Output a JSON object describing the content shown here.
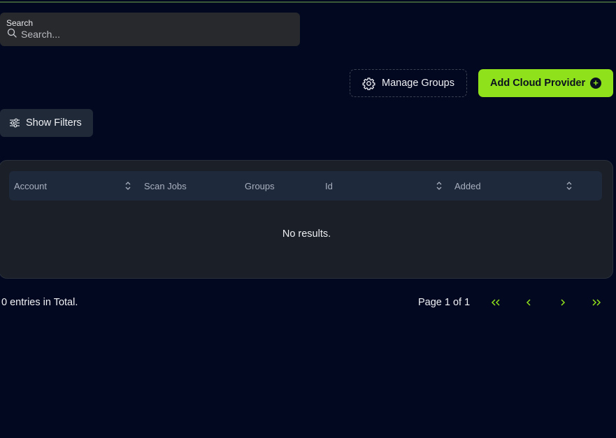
{
  "search": {
    "label": "Search",
    "placeholder": "Search...",
    "value": ""
  },
  "toolbar": {
    "manage_groups_label": "Manage Groups",
    "add_provider_label": "Add Cloud Provider",
    "show_filters_label": "Show Filters"
  },
  "table": {
    "columns": [
      {
        "label": "Account",
        "sortable": true
      },
      {
        "label": "Scan Jobs",
        "sortable": false
      },
      {
        "label": "Groups",
        "sortable": false
      },
      {
        "label": "Id",
        "sortable": true
      },
      {
        "label": "Added",
        "sortable": true
      }
    ],
    "rows": [],
    "empty_text": "No results."
  },
  "footer": {
    "total_text": "0 entries in Total.",
    "page_text": "Page 1 of 1"
  },
  "colors": {
    "background": "#030821",
    "accent": "#8fe11b",
    "card": "#1b1f27",
    "header_row": "#1e293b"
  },
  "icons": {
    "search": "search-icon",
    "manage_groups": "gear-icon",
    "add_provider": "plus-circle-icon",
    "filters": "sliders-icon",
    "sort": "chevron-up-down-icon",
    "first_page": "double-chevron-left-icon",
    "prev_page": "chevron-left-icon",
    "next_page": "chevron-right-icon",
    "last_page": "double-chevron-right-icon"
  }
}
